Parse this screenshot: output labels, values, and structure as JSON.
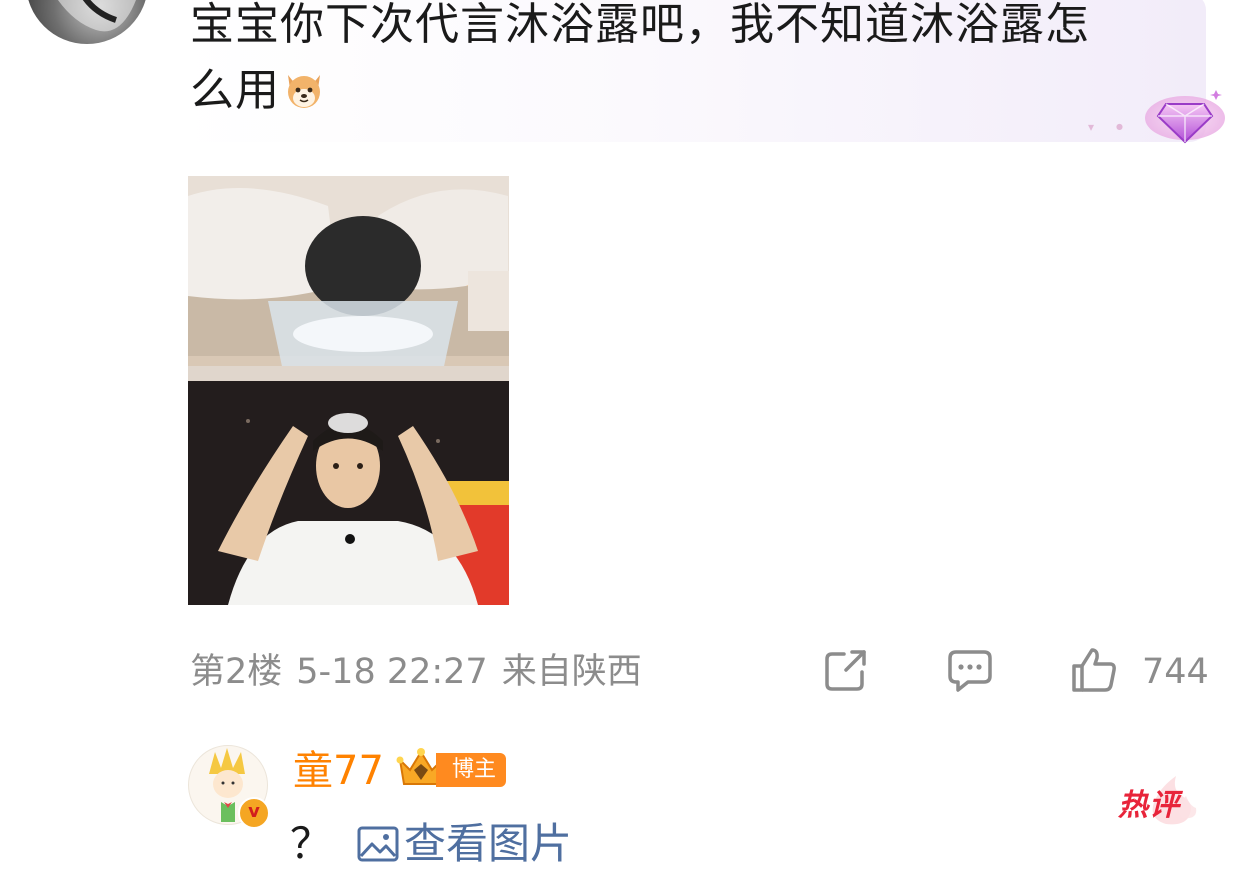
{
  "comment": {
    "text_line1": "宝宝你下次代言沐浴露吧，我不知道沐浴露怎",
    "text_line2": "么用",
    "emoji": "dog-emoji",
    "floor": "第2楼",
    "datetime": "5-18 22:27",
    "location": "来自陕西",
    "like_count": "744"
  },
  "reply": {
    "username": "童77",
    "badge": "博主",
    "verified_mark": "v",
    "text": "？",
    "view_image_label": "查看图片",
    "hot_label": "热评"
  },
  "icons": {
    "share": "share-icon",
    "comment": "comment-icon",
    "like": "thumbs-up-icon",
    "image": "image-icon"
  },
  "colors": {
    "username": "#ff8200",
    "link": "#4f6fa0",
    "meta": "#8c8c8c",
    "hot": "#e8243a"
  }
}
